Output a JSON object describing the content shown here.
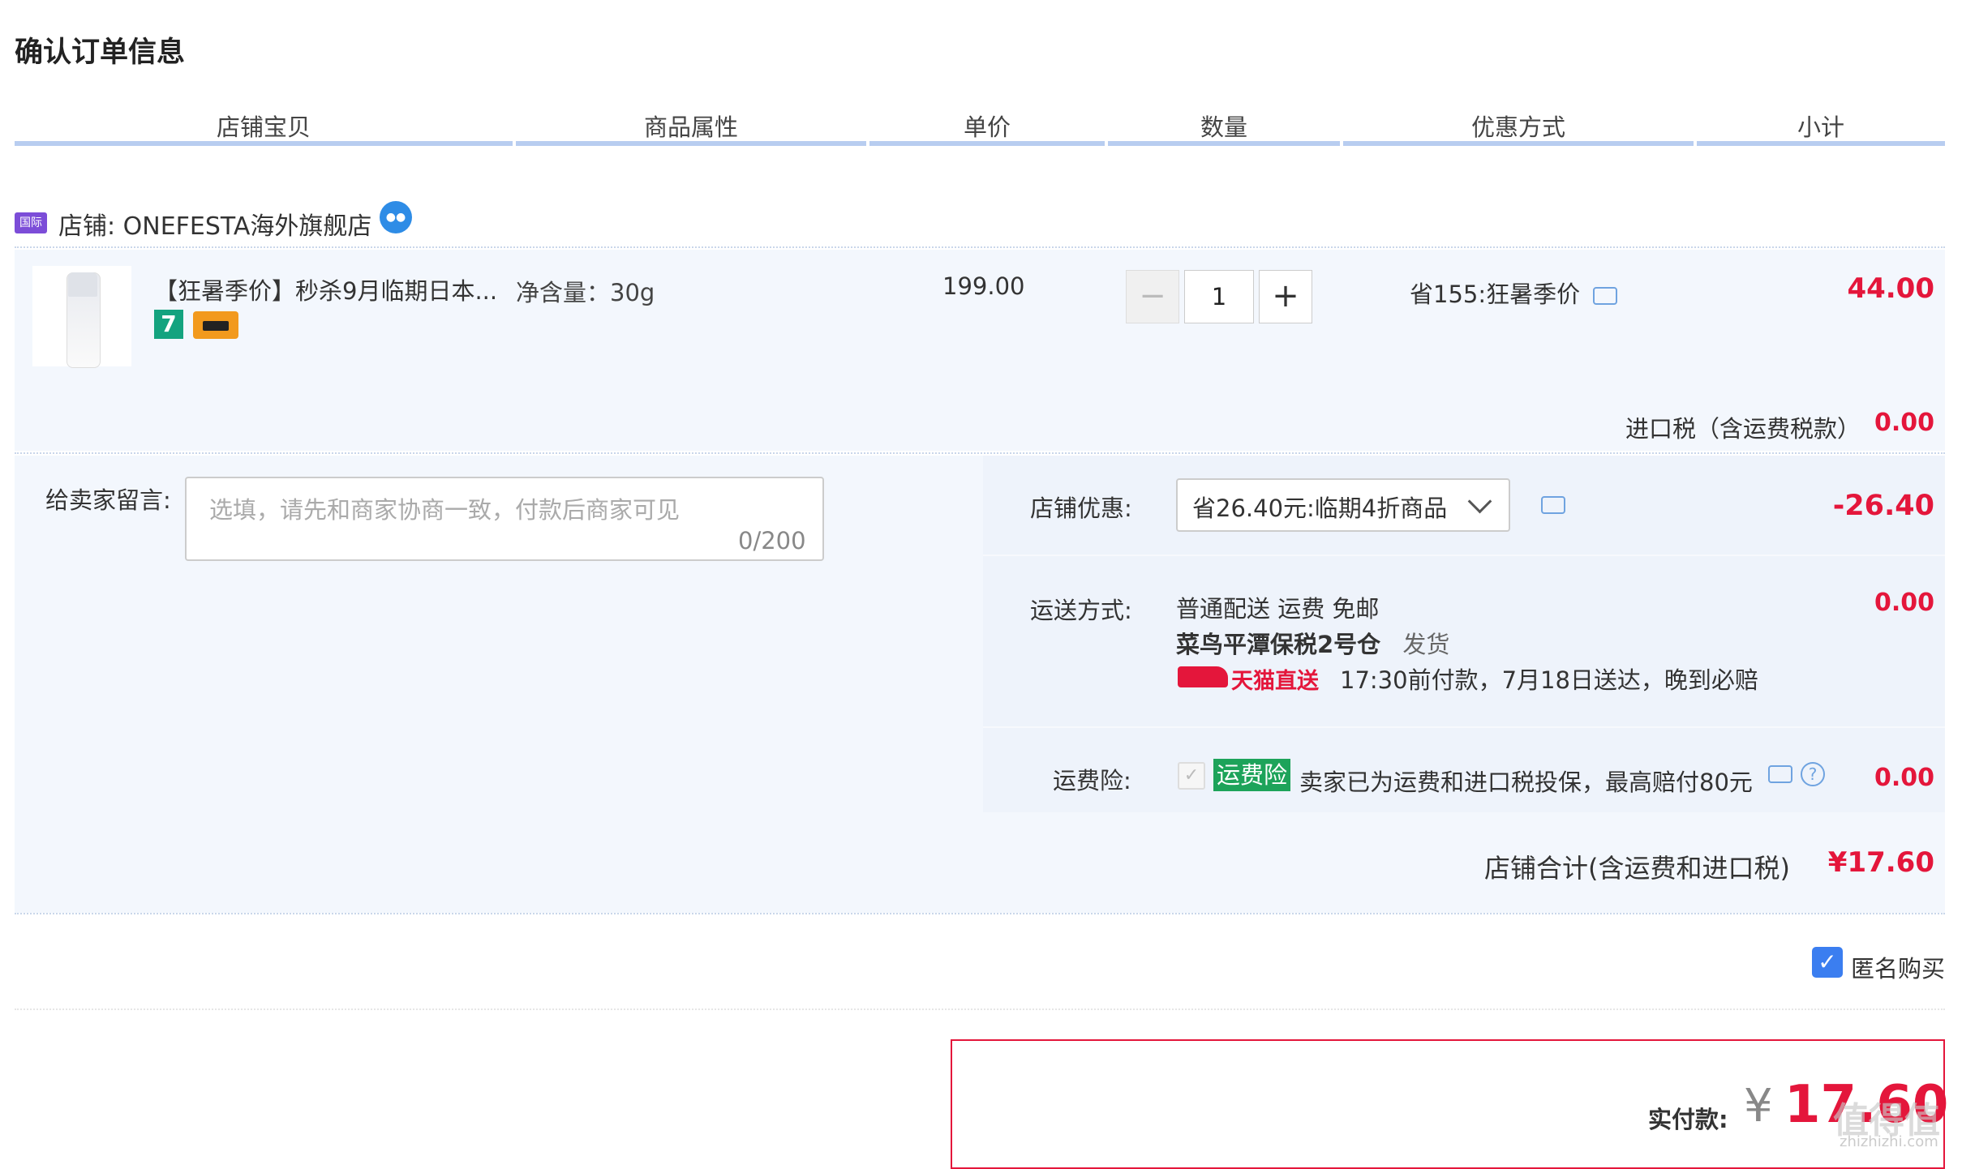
{
  "page_title": "确认订单信息",
  "columns": [
    "店铺宝贝",
    "商品属性",
    "单价",
    "数量",
    "优惠方式",
    "小计"
  ],
  "shop": {
    "badge": "国际",
    "name": "店铺: ONEFESTA海外旗舰店"
  },
  "item": {
    "title": "【狂暑季价】秒杀9月临期日本...",
    "tag_seven": "7",
    "attribute": "净含量：30g",
    "unit_price": "199.00",
    "quantity": "1",
    "minus": "−",
    "plus": "+",
    "promotion": "省155:狂暑季价",
    "subtotal": "44.00",
    "tax_label": "进口税（含运费税款）",
    "tax_value": "0.00"
  },
  "message": {
    "label": "给卖家留言:",
    "placeholder": "选填，请先和商家协商一致，付款后商家可见",
    "count": "0/200"
  },
  "shop_discount": {
    "label": "店铺优惠:",
    "selected": "省26.40元:临期4折商品",
    "value": "-26.40"
  },
  "shipping": {
    "label": "运送方式:",
    "line1": "普通配送 运费 免邮",
    "warehouse": "菜鸟平潭保税2号仓",
    "dispatch": "发货",
    "tmall_label": "天猫直送",
    "delivery_note": "17:30前付款，7月18日送达，晚到必赔",
    "value": "0.00"
  },
  "insurance": {
    "label": "运费险:",
    "badge": "运费险",
    "text": "卖家已为运费和进口税投保，最高赔付80元",
    "help": "?",
    "value": "0.00"
  },
  "shop_total": {
    "label": "店铺合计(含运费和进口税)",
    "value": "¥17.60"
  },
  "anonymous": {
    "label": "匿名购买",
    "checked": true
  },
  "payment": {
    "label": "实付款:",
    "currency": "¥",
    "amount": "17.60"
  },
  "watermark": {
    "text": "值得值",
    "url": "zhizhizhi.com"
  },
  "colors": {
    "price_red": "#e4163b",
    "header_line": "#b8cdf0",
    "row_bg": "#f3f7fd",
    "checkbox_blue": "#3b7ef0",
    "insurance_green": "#1da35a"
  }
}
